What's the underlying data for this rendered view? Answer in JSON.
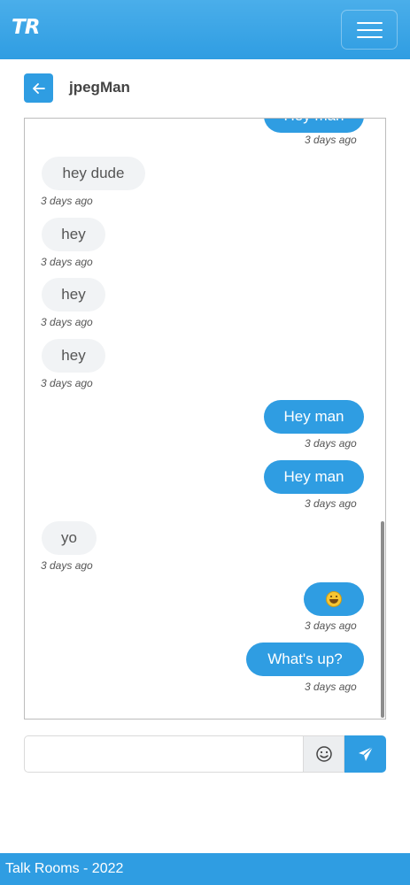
{
  "app": {
    "brand": "TR",
    "footer": "Talk Rooms - 2022"
  },
  "header": {
    "contact_name": "jpegMan"
  },
  "messages": [
    {
      "direction": "out",
      "text": "Hey man",
      "time": "3 days ago"
    },
    {
      "direction": "in",
      "text": "hey dude",
      "time": "3 days ago"
    },
    {
      "direction": "in",
      "text": "hey",
      "time": "3 days ago"
    },
    {
      "direction": "in",
      "text": "hey",
      "time": "3 days ago"
    },
    {
      "direction": "in",
      "text": "hey",
      "time": "3 days ago"
    },
    {
      "direction": "out",
      "text": "Hey man",
      "time": "3 days ago"
    },
    {
      "direction": "out",
      "text": "Hey man",
      "time": "3 days ago"
    },
    {
      "direction": "in",
      "text": "yo",
      "time": "3 days ago"
    },
    {
      "direction": "out",
      "text": "",
      "emoji": "grinning-face",
      "time": "3 days ago"
    },
    {
      "direction": "out",
      "text": "What's up?",
      "time": "3 days ago"
    }
  ],
  "composer": {
    "value": "",
    "placeholder": ""
  },
  "colors": {
    "primary": "#2f9de2",
    "incoming_bubble": "#f1f3f5"
  }
}
